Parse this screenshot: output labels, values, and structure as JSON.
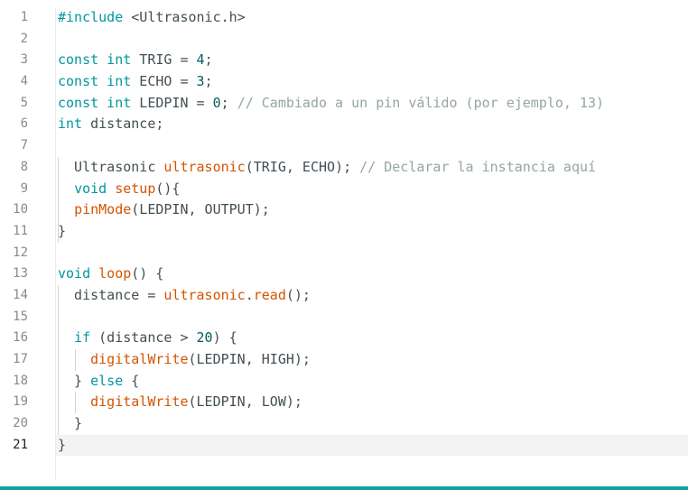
{
  "editor": {
    "current_line": 21,
    "accent_color": "#17a1a5",
    "lines": [
      {
        "n": "1",
        "t": [
          {
            "c": "kw",
            "s": "#include"
          },
          {
            "c": "",
            "s": " <Ultrasonic.h>"
          }
        ]
      },
      {
        "n": "2",
        "t": []
      },
      {
        "n": "3",
        "t": [
          {
            "c": "kw",
            "s": "const int"
          },
          {
            "c": "",
            "s": " TRIG = "
          },
          {
            "c": "num",
            "s": "4"
          },
          {
            "c": "",
            "s": ";"
          }
        ]
      },
      {
        "n": "4",
        "t": [
          {
            "c": "kw",
            "s": "const int"
          },
          {
            "c": "",
            "s": " ECHO = "
          },
          {
            "c": "num",
            "s": "3"
          },
          {
            "c": "",
            "s": ";"
          }
        ]
      },
      {
        "n": "5",
        "t": [
          {
            "c": "kw",
            "s": "const int"
          },
          {
            "c": "",
            "s": " LEDPIN = "
          },
          {
            "c": "num",
            "s": "0"
          },
          {
            "c": "",
            "s": "; "
          },
          {
            "c": "cm",
            "s": "// Cambiado a un pin válido (por ejemplo, 13)"
          }
        ]
      },
      {
        "n": "6",
        "t": [
          {
            "c": "kw",
            "s": "int"
          },
          {
            "c": "",
            "s": " distance;"
          }
        ]
      },
      {
        "n": "7",
        "t": []
      },
      {
        "n": "8",
        "t": [
          {
            "c": "",
            "s": "  Ultrasonic "
          },
          {
            "c": "fn",
            "s": "ultrasonic"
          },
          {
            "c": "",
            "s": "(TRIG, ECHO); "
          },
          {
            "c": "cm",
            "s": "// Declarar la instancia aquí"
          }
        ]
      },
      {
        "n": "9",
        "t": [
          {
            "c": "",
            "s": "  "
          },
          {
            "c": "kw",
            "s": "void"
          },
          {
            "c": "",
            "s": " "
          },
          {
            "c": "fn",
            "s": "setup"
          },
          {
            "c": "",
            "s": "(){"
          }
        ]
      },
      {
        "n": "10",
        "t": [
          {
            "c": "",
            "s": "  "
          },
          {
            "c": "fn",
            "s": "pinMode"
          },
          {
            "c": "",
            "s": "(LEDPIN, OUTPUT);"
          }
        ]
      },
      {
        "n": "11",
        "t": [
          {
            "c": "",
            "s": "}"
          }
        ]
      },
      {
        "n": "12",
        "t": []
      },
      {
        "n": "13",
        "t": [
          {
            "c": "kw",
            "s": "void"
          },
          {
            "c": "",
            "s": " "
          },
          {
            "c": "fn",
            "s": "loop"
          },
          {
            "c": "",
            "s": "() {"
          }
        ]
      },
      {
        "n": "14",
        "t": [
          {
            "c": "",
            "s": "  distance = "
          },
          {
            "c": "fn",
            "s": "ultrasonic"
          },
          {
            "c": "",
            "s": "."
          },
          {
            "c": "fn",
            "s": "read"
          },
          {
            "c": "",
            "s": "();"
          }
        ]
      },
      {
        "n": "15",
        "t": []
      },
      {
        "n": "16",
        "t": [
          {
            "c": "",
            "s": "  "
          },
          {
            "c": "kw",
            "s": "if"
          },
          {
            "c": "",
            "s": " (distance > "
          },
          {
            "c": "num",
            "s": "20"
          },
          {
            "c": "",
            "s": ") {"
          }
        ]
      },
      {
        "n": "17",
        "t": [
          {
            "c": "",
            "s": "    "
          },
          {
            "c": "fn",
            "s": "digitalWrite"
          },
          {
            "c": "",
            "s": "(LEDPIN, HIGH);"
          }
        ]
      },
      {
        "n": "18",
        "t": [
          {
            "c": "",
            "s": "  } "
          },
          {
            "c": "kw",
            "s": "else"
          },
          {
            "c": "",
            "s": " {"
          }
        ]
      },
      {
        "n": "19",
        "t": [
          {
            "c": "",
            "s": "    "
          },
          {
            "c": "fn",
            "s": "digitalWrite"
          },
          {
            "c": "",
            "s": "(LEDPIN, LOW);"
          }
        ]
      },
      {
        "n": "20",
        "t": [
          {
            "c": "",
            "s": "  }"
          }
        ]
      },
      {
        "n": "21",
        "t": [
          {
            "c": "",
            "s": "}"
          }
        ]
      }
    ]
  }
}
